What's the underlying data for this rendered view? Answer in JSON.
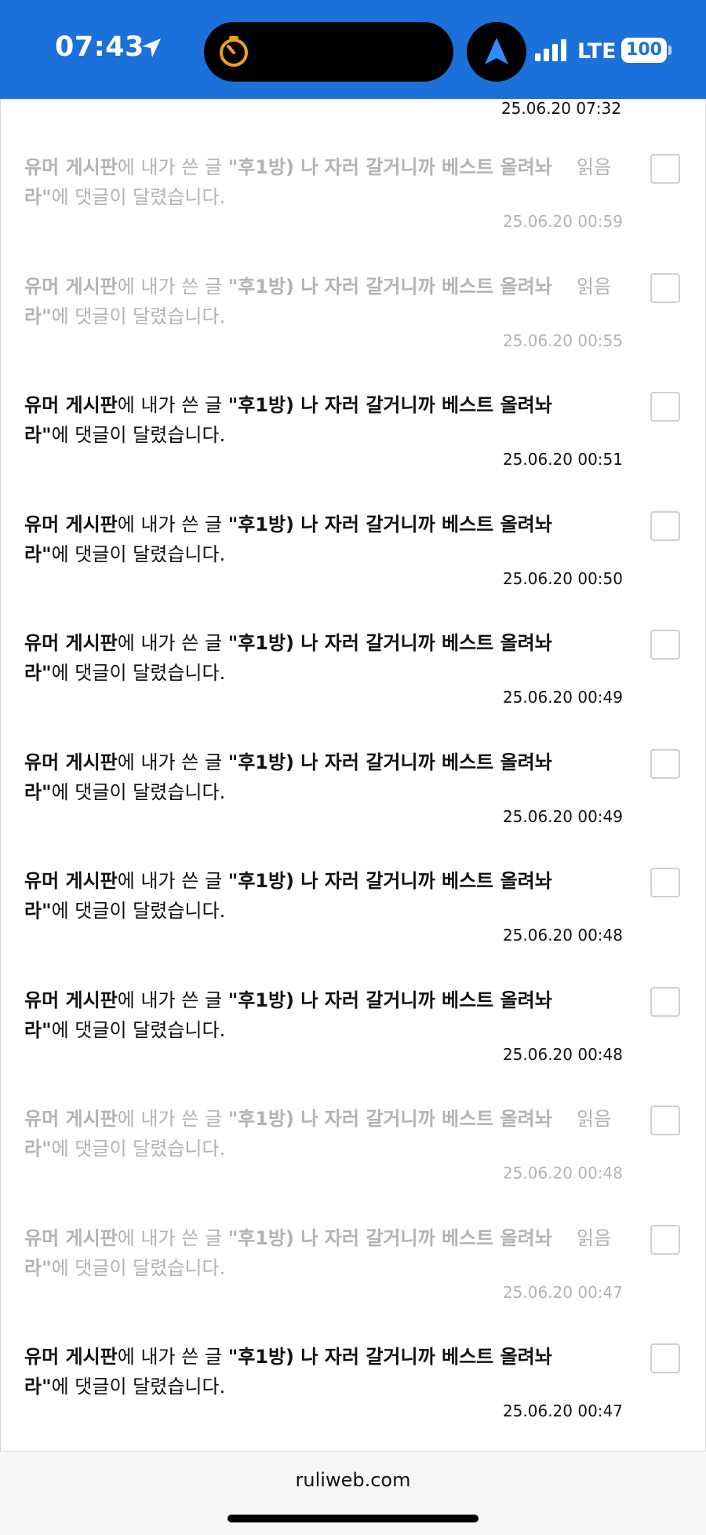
{
  "status_bar": {
    "time": "07:43",
    "lte_label": "LTE",
    "battery": "100",
    "background_color": "#1b70d9",
    "timer_color": "#f0a013",
    "nav_arrow_color": "#2f8cff"
  },
  "list": {
    "top_partial_date": "25.06.20 07:32",
    "read_label": "읽음",
    "items": [
      {
        "board": "유머 게시판",
        "mid": "에 내가 쓴 글 ",
        "title1": "\"후1방) 나 자러 갈거니까 베스트 올려놔",
        "title2": "라\"",
        "tail": "에 댓글이 달렸습니다.",
        "date": "25.06.20 00:59",
        "read": true
      },
      {
        "board": "유머 게시판",
        "mid": "에 내가 쓴 글 ",
        "title1": "\"후1방) 나 자러 갈거니까 베스트 올려놔",
        "title2": "라\"",
        "tail": "에 댓글이 달렸습니다.",
        "date": "25.06.20 00:55",
        "read": true
      },
      {
        "board": "유머 게시판",
        "mid": "에 내가 쓴 글 ",
        "title1": "\"후1방) 나 자러 갈거니까 베스트 올려놔",
        "title2": "라\"",
        "tail": "에 댓글이 달렸습니다.",
        "date": "25.06.20 00:51",
        "read": false
      },
      {
        "board": "유머 게시판",
        "mid": "에 내가 쓴 글 ",
        "title1": "\"후1방) 나 자러 갈거니까 베스트 올려놔",
        "title2": "라\"",
        "tail": "에 댓글이 달렸습니다.",
        "date": "25.06.20 00:50",
        "read": false
      },
      {
        "board": "유머 게시판",
        "mid": "에 내가 쓴 글 ",
        "title1": "\"후1방) 나 자러 갈거니까 베스트 올려놔",
        "title2": "라\"",
        "tail": "에 댓글이 달렸습니다.",
        "date": "25.06.20 00:49",
        "read": false
      },
      {
        "board": "유머 게시판",
        "mid": "에 내가 쓴 글 ",
        "title1": "\"후1방) 나 자러 갈거니까 베스트 올려놔",
        "title2": "라\"",
        "tail": "에 댓글이 달렸습니다.",
        "date": "25.06.20 00:49",
        "read": false
      },
      {
        "board": "유머 게시판",
        "mid": "에 내가 쓴 글 ",
        "title1": "\"후1방) 나 자러 갈거니까 베스트 올려놔",
        "title2": "라\"",
        "tail": "에 댓글이 달렸습니다.",
        "date": "25.06.20 00:48",
        "read": false
      },
      {
        "board": "유머 게시판",
        "mid": "에 내가 쓴 글 ",
        "title1": "\"후1방) 나 자러 갈거니까 베스트 올려놔",
        "title2": "라\"",
        "tail": "에 댓글이 달렸습니다.",
        "date": "25.06.20 00:48",
        "read": false
      },
      {
        "board": "유머 게시판",
        "mid": "에 내가 쓴 글 ",
        "title1": "\"후1방) 나 자러 갈거니까 베스트 올려놔",
        "title2": "라\"",
        "tail": "에 댓글이 달렸습니다.",
        "date": "25.06.20 00:48",
        "read": true
      },
      {
        "board": "유머 게시판",
        "mid": "에 내가 쓴 글 ",
        "title1": "\"후1방) 나 자러 갈거니까 베스트 올려놔",
        "title2": "라\"",
        "tail": "에 댓글이 달렸습니다.",
        "date": "25.06.20 00:47",
        "read": true
      },
      {
        "board": "유머 게시판",
        "mid": "에 내가 쓴 글 ",
        "title1": "\"후1방) 나 자러 갈거니까 베스트 올려놔",
        "title2": "라\"",
        "tail": "에 댓글이 달렸습니다.",
        "date": "25.06.20 00:47",
        "read": false
      }
    ]
  },
  "browser": {
    "url": "ruliweb.com"
  }
}
